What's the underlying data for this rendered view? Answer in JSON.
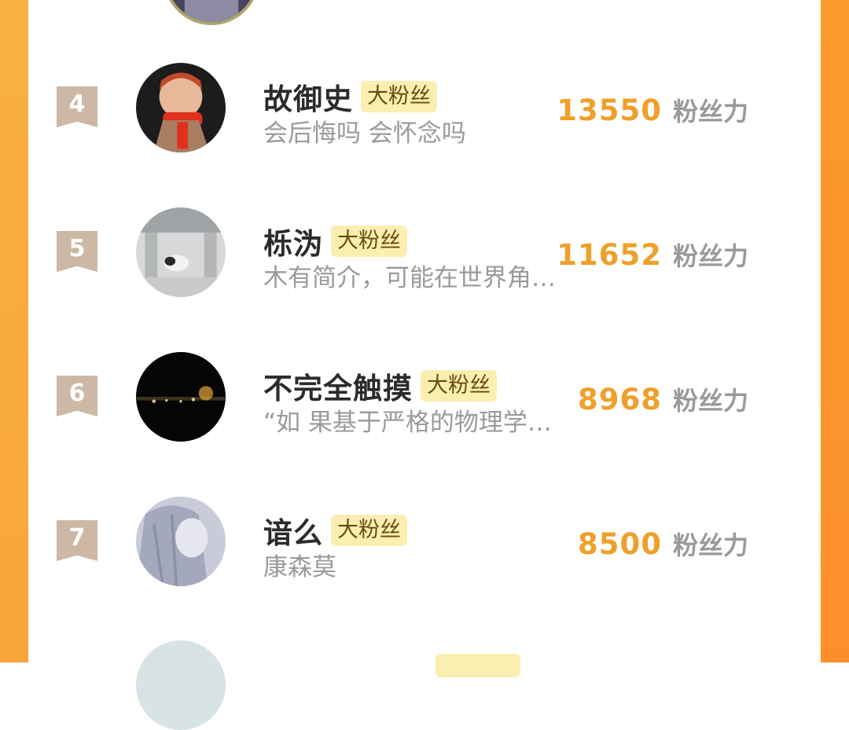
{
  "colors": {
    "rank_ribbon": "#cdb8a6",
    "score": "#eea02a",
    "badge_bg": "#fbeeb1",
    "side_orange": "#f9a53a"
  },
  "entries": [
    {
      "rank": "4",
      "name": "故御史",
      "badge": "大粉丝",
      "intro": "会后悔吗 会怀念吗",
      "score": "13550",
      "unit": "粉丝力"
    },
    {
      "rank": "5",
      "name": "栎沩",
      "badge": "大粉丝",
      "intro": "木有简介，可能在世界角…",
      "score": "11652",
      "unit": "粉丝力"
    },
    {
      "rank": "6",
      "name": "不完全触摸",
      "badge": "大粉丝",
      "intro": "“如  果基于严格的物理学…",
      "score": "8968",
      "unit": "粉丝力"
    },
    {
      "rank": "7",
      "name": "谙么",
      "badge": "大粉丝",
      "intro": "康森莫",
      "score": "8500",
      "unit": "粉丝力"
    }
  ]
}
